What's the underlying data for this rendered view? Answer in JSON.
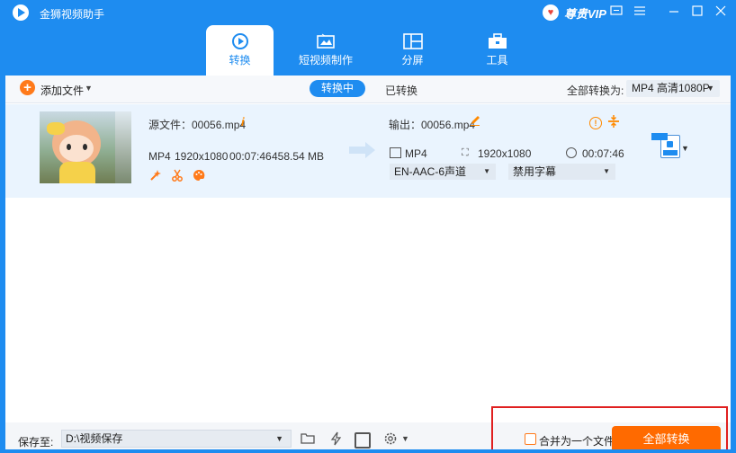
{
  "window": {
    "title": "金狮视频助手",
    "vip_label": "尊贵VIP",
    "controls": [
      "feedback",
      "menu",
      "minimize",
      "maximize",
      "close"
    ]
  },
  "nav_tabs": [
    {
      "label": "转换",
      "icon": "convert-icon",
      "active": true
    },
    {
      "label": "短视频制作",
      "icon": "short-video-icon",
      "active": false
    },
    {
      "label": "分屏",
      "icon": "split-screen-icon",
      "active": false
    },
    {
      "label": "工具",
      "icon": "toolbox-icon",
      "active": false
    }
  ],
  "toolbar": {
    "add_file_label": "添加文件",
    "segment_converting": "转换中",
    "segment_converted": "已转换",
    "convert_all_to_label": "全部转换为:",
    "convert_all_to_value": "MP4 高清1080P"
  },
  "file_item": {
    "source_label": "源文件：00056.mp4",
    "source_format": "MP4",
    "source_resolution": "1920x1080",
    "source_duration": "00:07:46",
    "source_size": "458.54 MB",
    "output_label": "输出：00056.mp4",
    "output_format": "MP4",
    "output_resolution": "1920x1080",
    "output_duration": "00:07:46",
    "audio_track": "EN-AAC-6声道",
    "subtitle": "禁用字幕"
  },
  "bottom": {
    "save_to_label": "保存至:",
    "save_path": "D:\\视频保存",
    "merge_label": "合并为一个文件",
    "convert_all_button": "全部转换"
  },
  "colors": {
    "primary": "#1e8cf0",
    "accent": "#ff6a00",
    "highlight_box": "#e02020"
  }
}
